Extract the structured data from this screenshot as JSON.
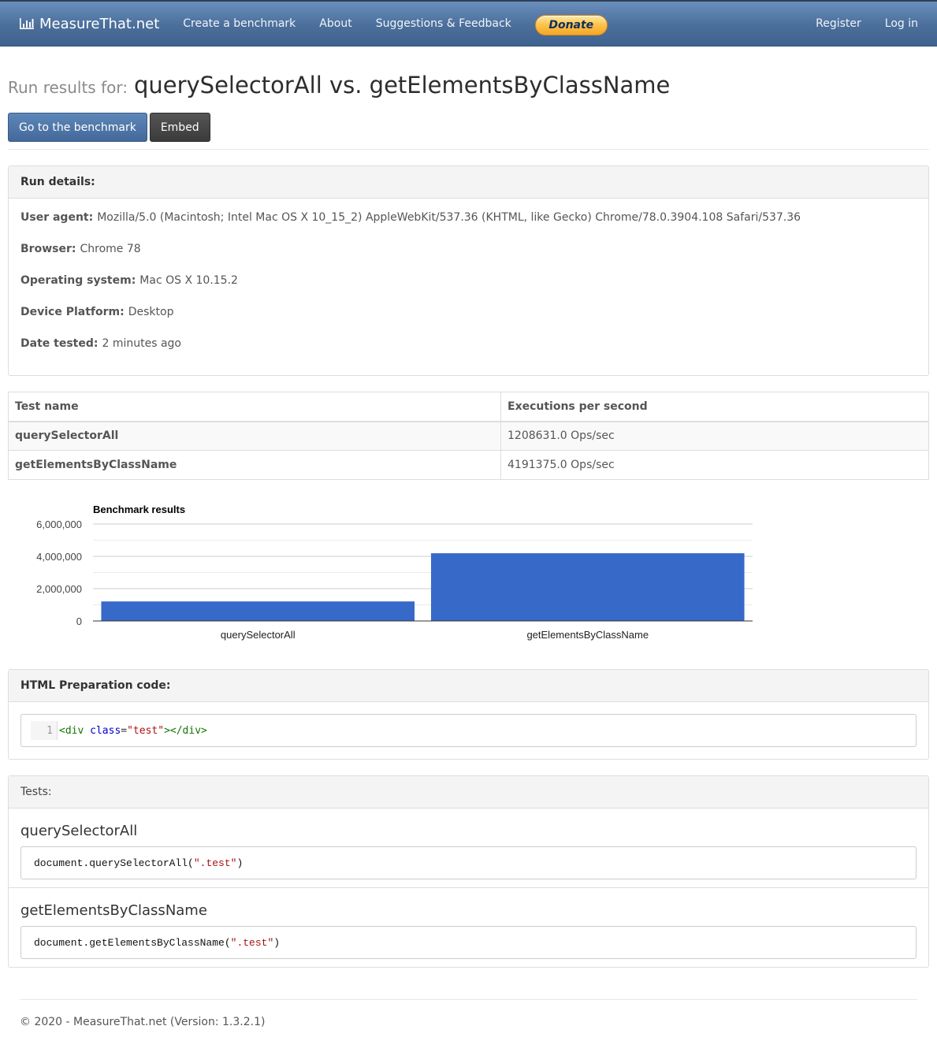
{
  "navbar": {
    "brand": "MeasureThat.net",
    "brand_icon": "bar-chart-icon",
    "links": [
      "Create a benchmark",
      "About",
      "Suggestions & Feedback"
    ],
    "donate_label": "Donate",
    "right_links": [
      "Register",
      "Log in"
    ]
  },
  "header": {
    "prefix": "Run results for:",
    "title": "querySelectorAll vs. getElementsByClassName",
    "go_button": "Go to the benchmark",
    "embed_button": "Embed"
  },
  "run_details": {
    "heading": "Run details:",
    "items": [
      {
        "label": "User agent:",
        "value": "Mozilla/5.0 (Macintosh; Intel Mac OS X 10_15_2) AppleWebKit/537.36 (KHTML, like Gecko) Chrome/78.0.3904.108 Safari/537.36"
      },
      {
        "label": "Browser:",
        "value": "Chrome 78"
      },
      {
        "label": "Operating system:",
        "value": "Mac OS X 10.15.2"
      },
      {
        "label": "Device Platform:",
        "value": "Desktop"
      },
      {
        "label": "Date tested:",
        "value": "2 minutes ago"
      }
    ]
  },
  "results_table": {
    "headers": [
      "Test name",
      "Executions per second"
    ],
    "rows": [
      {
        "name": "querySelectorAll",
        "value": "1208631.0 Ops/sec"
      },
      {
        "name": "getElementsByClassName",
        "value": "4191375.0 Ops/sec"
      }
    ]
  },
  "chart_data": {
    "type": "bar",
    "title": "Benchmark results",
    "categories": [
      "querySelectorAll",
      "getElementsByClassName"
    ],
    "values": [
      1208631.0,
      4191375.0
    ],
    "xlabel": "",
    "ylabel": "",
    "ylim": [
      0,
      6000000
    ],
    "y_ticks": [
      0,
      2000000,
      4000000,
      6000000
    ],
    "y_tick_labels": [
      "0",
      "2,000,000",
      "4,000,000",
      "6,000,000"
    ],
    "grid": true,
    "legend": "none",
    "bar_color": "#3769c9"
  },
  "html_prep": {
    "heading": "HTML Preparation code:",
    "line_number": "1",
    "tokens": [
      {
        "type": "tag",
        "text": "<div"
      },
      {
        "type": "plain",
        "text": " "
      },
      {
        "type": "attr",
        "text": "class"
      },
      {
        "type": "plain",
        "text": "="
      },
      {
        "type": "str",
        "text": "\"test\""
      },
      {
        "type": "tag",
        "text": "></div>"
      }
    ]
  },
  "tests": {
    "heading": "Tests:",
    "items": [
      {
        "title": "querySelectorAll",
        "code_before": "document.querySelectorAll(",
        "code_str": "\".test\"",
        "code_after": ")"
      },
      {
        "title": "getElementsByClassName",
        "code_before": "document.getElementsByClassName(",
        "code_str": "\".test\"",
        "code_after": ")"
      }
    ]
  },
  "footer": {
    "text": "© 2020 - MeasureThat.net (Version: 1.3.2.1)"
  }
}
